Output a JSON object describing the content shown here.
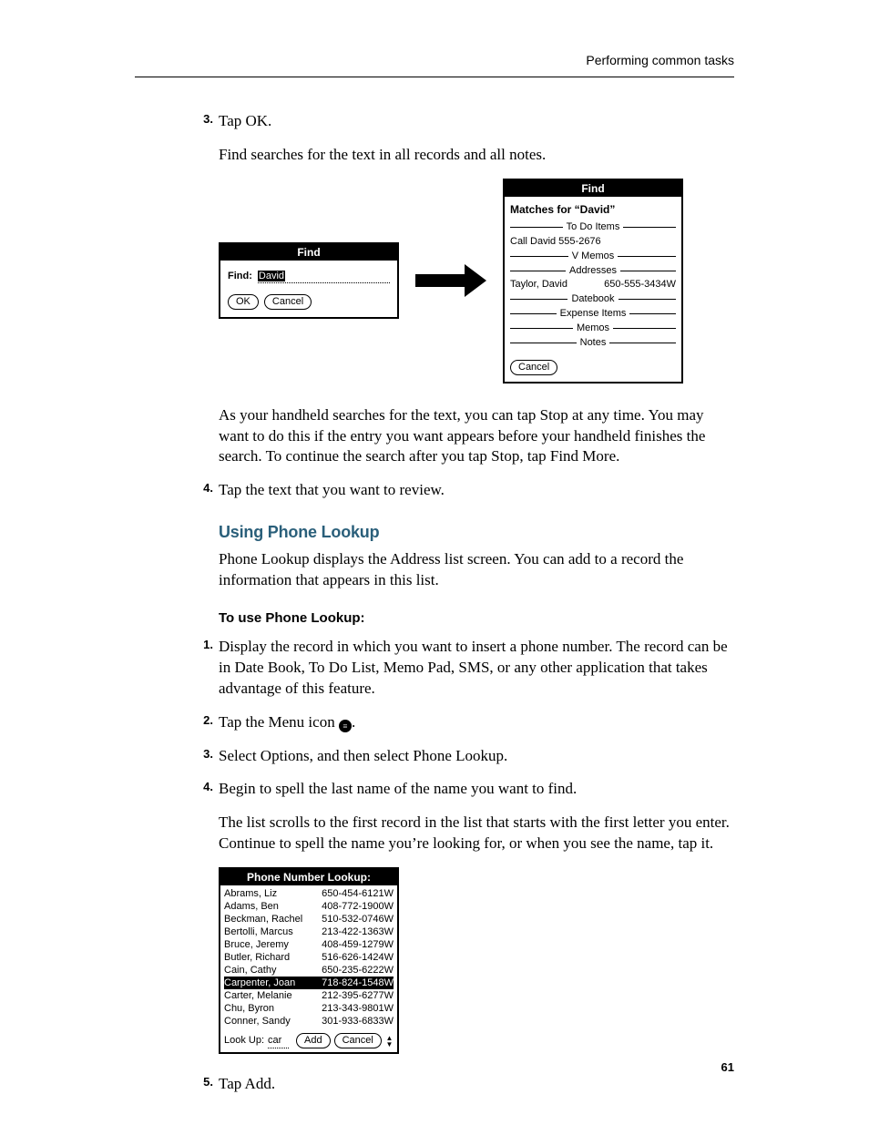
{
  "running_head": "Performing common tasks",
  "page_number": "61",
  "steps_a": {
    "s3_num": "3.",
    "s3_text": "Tap OK.",
    "s3_follow": "Find searches for the text in all records and all notes.",
    "s3_after": "As your handheld searches for the text, you can tap Stop at any time. You may want to do this if the entry you want appears before your handheld finishes the search. To continue the search after you tap Stop, tap Find More.",
    "s4_num": "4.",
    "s4_text": "Tap the text that you want to review."
  },
  "h2": "Using Phone Lookup",
  "h2_para": "Phone Lookup displays the Address list screen. You can add to a record the information that appears in this list.",
  "h3": "To use Phone Lookup:",
  "steps_b": {
    "s1_num": "1.",
    "s1_text": "Display the record in which you want to insert a phone number. The record can be in Date Book, To Do List, Memo Pad, SMS, or any other application that takes advantage of this feature.",
    "s2_num": "2.",
    "s2_text_a": "Tap the Menu icon ",
    "s2_text_b": ".",
    "s3_num": "3.",
    "s3_text": "Select Options, and then select Phone Lookup.",
    "s4_num": "4.",
    "s4_text": "Begin to spell the last name of the name you want to find.",
    "s4_follow": "The list scrolls to the first record in the list that starts with the first letter you enter. Continue to spell the name you’re looking for, or when you see the name, tap it.",
    "s5_num": "5.",
    "s5_text": "Tap Add."
  },
  "find_dialog": {
    "title": "Find",
    "label": "Find:",
    "value": "David",
    "ok": "OK",
    "cancel": "Cancel"
  },
  "results_dialog": {
    "title": "Find",
    "matches": "Matches for “David”",
    "sections": [
      "To Do Items",
      "V Memos",
      "Addresses",
      "Datebook",
      "Expense Items",
      "Memos",
      "Notes"
    ],
    "todo_line": "Call David 555-2676",
    "addr_name": "Taylor, David",
    "addr_phone": "650-555-3434W",
    "cancel": "Cancel"
  },
  "phone_lookup": {
    "title": "Phone Number Lookup:",
    "rows": [
      {
        "n": "Abrams, Liz",
        "p": "650-454-6121W"
      },
      {
        "n": "Adams, Ben",
        "p": "408-772-1900W"
      },
      {
        "n": "Beckman, Rachel",
        "p": "510-532-0746W"
      },
      {
        "n": "Bertolli, Marcus",
        "p": "213-422-1363W"
      },
      {
        "n": "Bruce, Jeremy",
        "p": "408-459-1279W"
      },
      {
        "n": "Butler, Richard",
        "p": "516-626-1424W"
      },
      {
        "n": "Cain, Cathy",
        "p": "650-235-6222W"
      },
      {
        "n": "Carpenter, Joan",
        "p": "718-824-1548W",
        "sel": true
      },
      {
        "n": "Carter, Melanie",
        "p": "212-395-6277W"
      },
      {
        "n": "Chu, Byron",
        "p": "213-343-9801W"
      },
      {
        "n": "Conner, Sandy",
        "p": "301-933-6833W"
      }
    ],
    "lookup_label": "Look Up:",
    "lookup_value": "car",
    "add": "Add",
    "cancel": "Cancel"
  }
}
